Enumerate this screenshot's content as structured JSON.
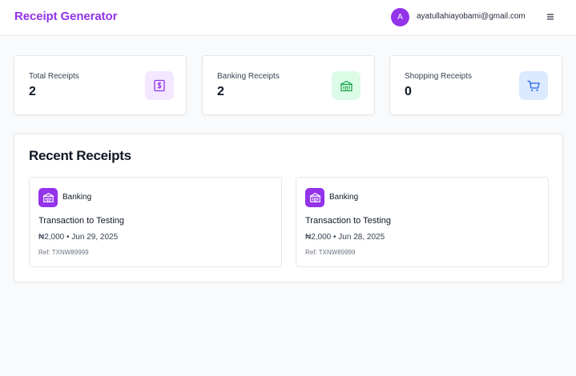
{
  "header": {
    "brand": "Receipt Generator",
    "avatar_initial": "A",
    "email": "ayatullahiayobami@gmail.com",
    "menu_icon": "hamburger-menu-icon",
    "brand_color": "#9333ea"
  },
  "stats": [
    {
      "label": "Total Receipts",
      "value": "2",
      "icon": "receipt-dollar-icon",
      "icon_bg": "#f3e8ff",
      "icon_color": "#9333ea"
    },
    {
      "label": "Banking Receipts",
      "value": "2",
      "icon": "bank-building-icon",
      "icon_bg": "#dcfce7",
      "icon_color": "#16a34a"
    },
    {
      "label": "Shopping Receipts",
      "value": "0",
      "icon": "shopping-cart-icon",
      "icon_bg": "#dbeafe",
      "icon_color": "#2563eb"
    }
  ],
  "recent": {
    "title": "Recent Receipts",
    "items": [
      {
        "category": "Banking",
        "title": "Transaction to Testing",
        "meta": "₦2,000 • Jun 29, 2025",
        "ref": "Ref: TXNW89999",
        "icon": "bank-building-icon"
      },
      {
        "category": "Banking",
        "title": "Transaction to Testing",
        "meta": "₦2,000 • Jun 28, 2025",
        "ref": "Ref: TXNW89999",
        "icon": "bank-building-icon"
      }
    ]
  }
}
